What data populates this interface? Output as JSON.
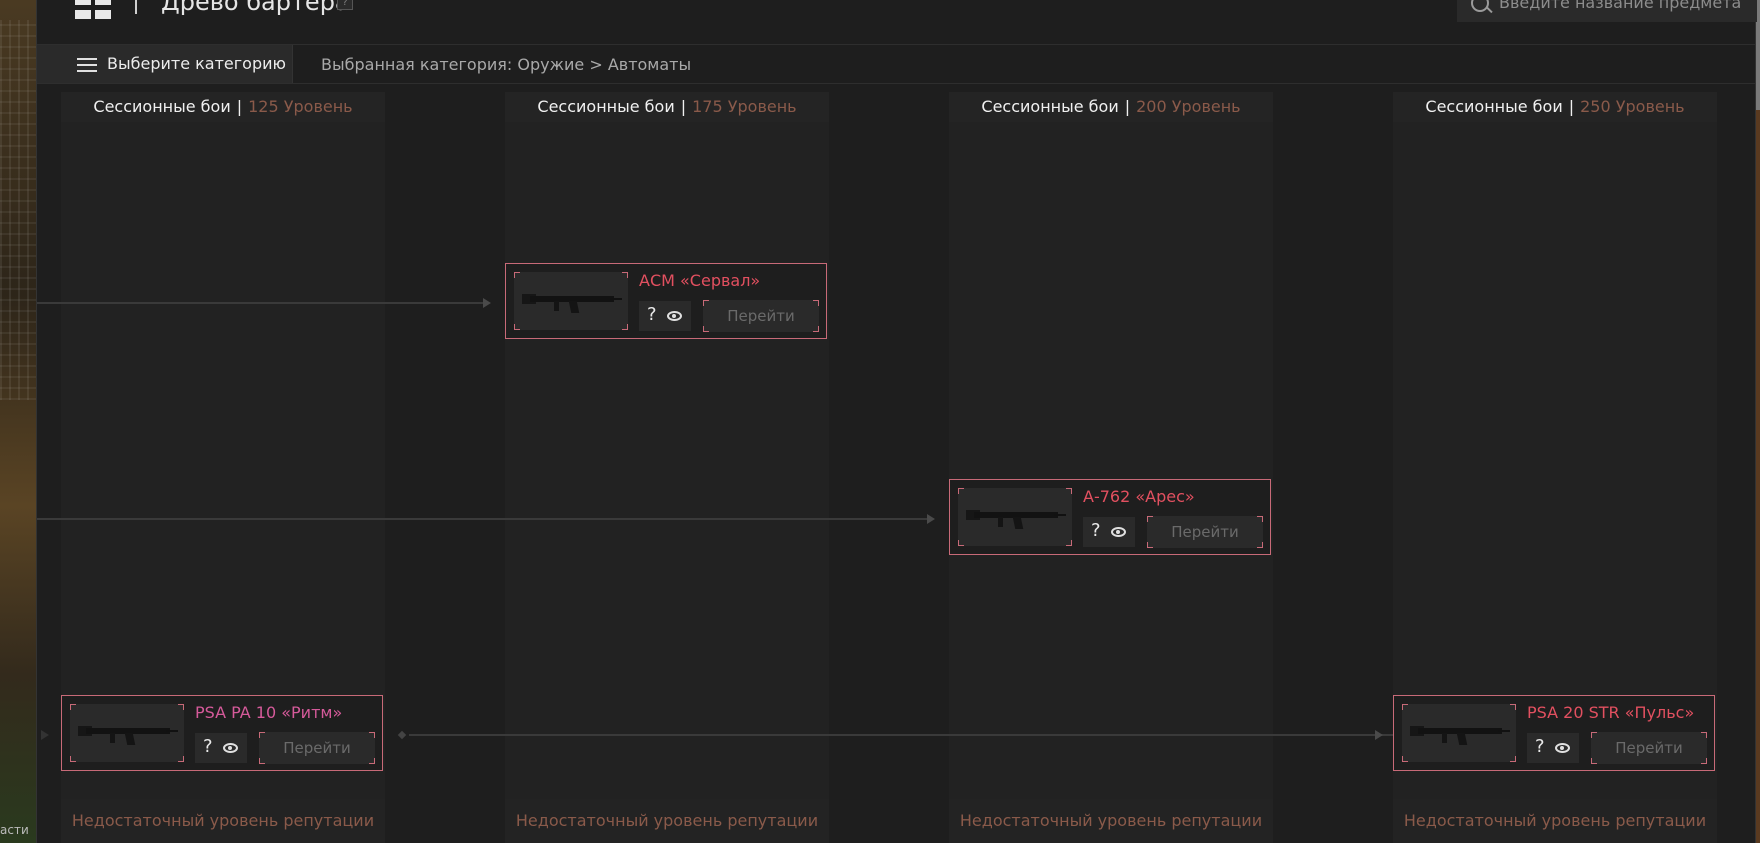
{
  "header": {
    "title": "Древо бартера",
    "help_label": "?",
    "search_placeholder": "Введите название предмета"
  },
  "category_bar": {
    "button_label": "Выберите категорию",
    "selected_path": "Выбранная категория: Оружие > Автоматы"
  },
  "columns": [
    {
      "mode": "Сессионные бои",
      "separator": "|",
      "level": "125 Уровень",
      "footer": "Недостаточный уровень репутации"
    },
    {
      "mode": "Сессионные бои",
      "separator": "|",
      "level": "175 Уровень",
      "footer": "Недостаточный уровень репутации"
    },
    {
      "mode": "Сессионные бои",
      "separator": "|",
      "level": "200 Уровень",
      "footer": "Недостаточный уровень репутации"
    },
    {
      "mode": "Сессионные бои",
      "separator": "|",
      "level": "250 Уровень",
      "footer": "Недостаточный уровень репутации"
    }
  ],
  "items": [
    {
      "name": "АСМ «Сервал»",
      "help": "?",
      "go_label": "Перейти",
      "name_color": "#e25060"
    },
    {
      "name": "А-762 «Арес»",
      "help": "?",
      "go_label": "Перейти",
      "name_color": "#e25060"
    },
    {
      "name": "PSA PA 10 «Ритм»",
      "help": "?",
      "go_label": "Перейти",
      "name_color": "#d55a9a"
    },
    {
      "name": "PSA 20 STR «Пульс»",
      "help": "?",
      "go_label": "Перейти",
      "name_color": "#e25060"
    }
  ],
  "background_text": "асти",
  "colors": {
    "accent_border": "#c86a78",
    "level_text": "#8a5a4a",
    "panel": "#1e1e1e"
  }
}
